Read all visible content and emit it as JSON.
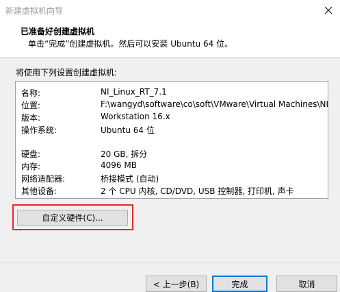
{
  "window": {
    "title": "新建虚拟机向导",
    "close_icon": "close-icon"
  },
  "header": {
    "title": "已准备好创建虚拟机",
    "subtitle": "单击“完成”创建虚拟机。然后可以安装 Ubuntu 64 位。"
  },
  "settings": {
    "label": "将使用下列设置创建虚拟机:",
    "rows": [
      {
        "key": "名称:",
        "value": "NI_Linux_RT_7.1"
      },
      {
        "key": "位置:",
        "value": "F:\\wangyd\\software\\co\\soft\\VMware\\Virtual Machines\\NI_..."
      },
      {
        "key": "版本:",
        "value": "Workstation 16.x"
      },
      {
        "key": "操作系统:",
        "value": "Ubuntu 64 位"
      },
      {
        "key": "硬盘:",
        "value": "20 GB, 拆分"
      },
      {
        "key": "内存:",
        "value": "4096 MB"
      },
      {
        "key": "网络适配器:",
        "value": "桥接模式 (自动)"
      },
      {
        "key": "其他设备:",
        "value": "2 个 CPU 内核, CD/DVD, USB 控制器, 打印机, 声卡"
      }
    ]
  },
  "buttons": {
    "customize": "自定义硬件(C)...",
    "back": "< 上一步(B)",
    "finish": "完成",
    "cancel": "取消"
  },
  "colors": {
    "highlight": "#e8262c",
    "default_button_border": "#0078d7"
  }
}
